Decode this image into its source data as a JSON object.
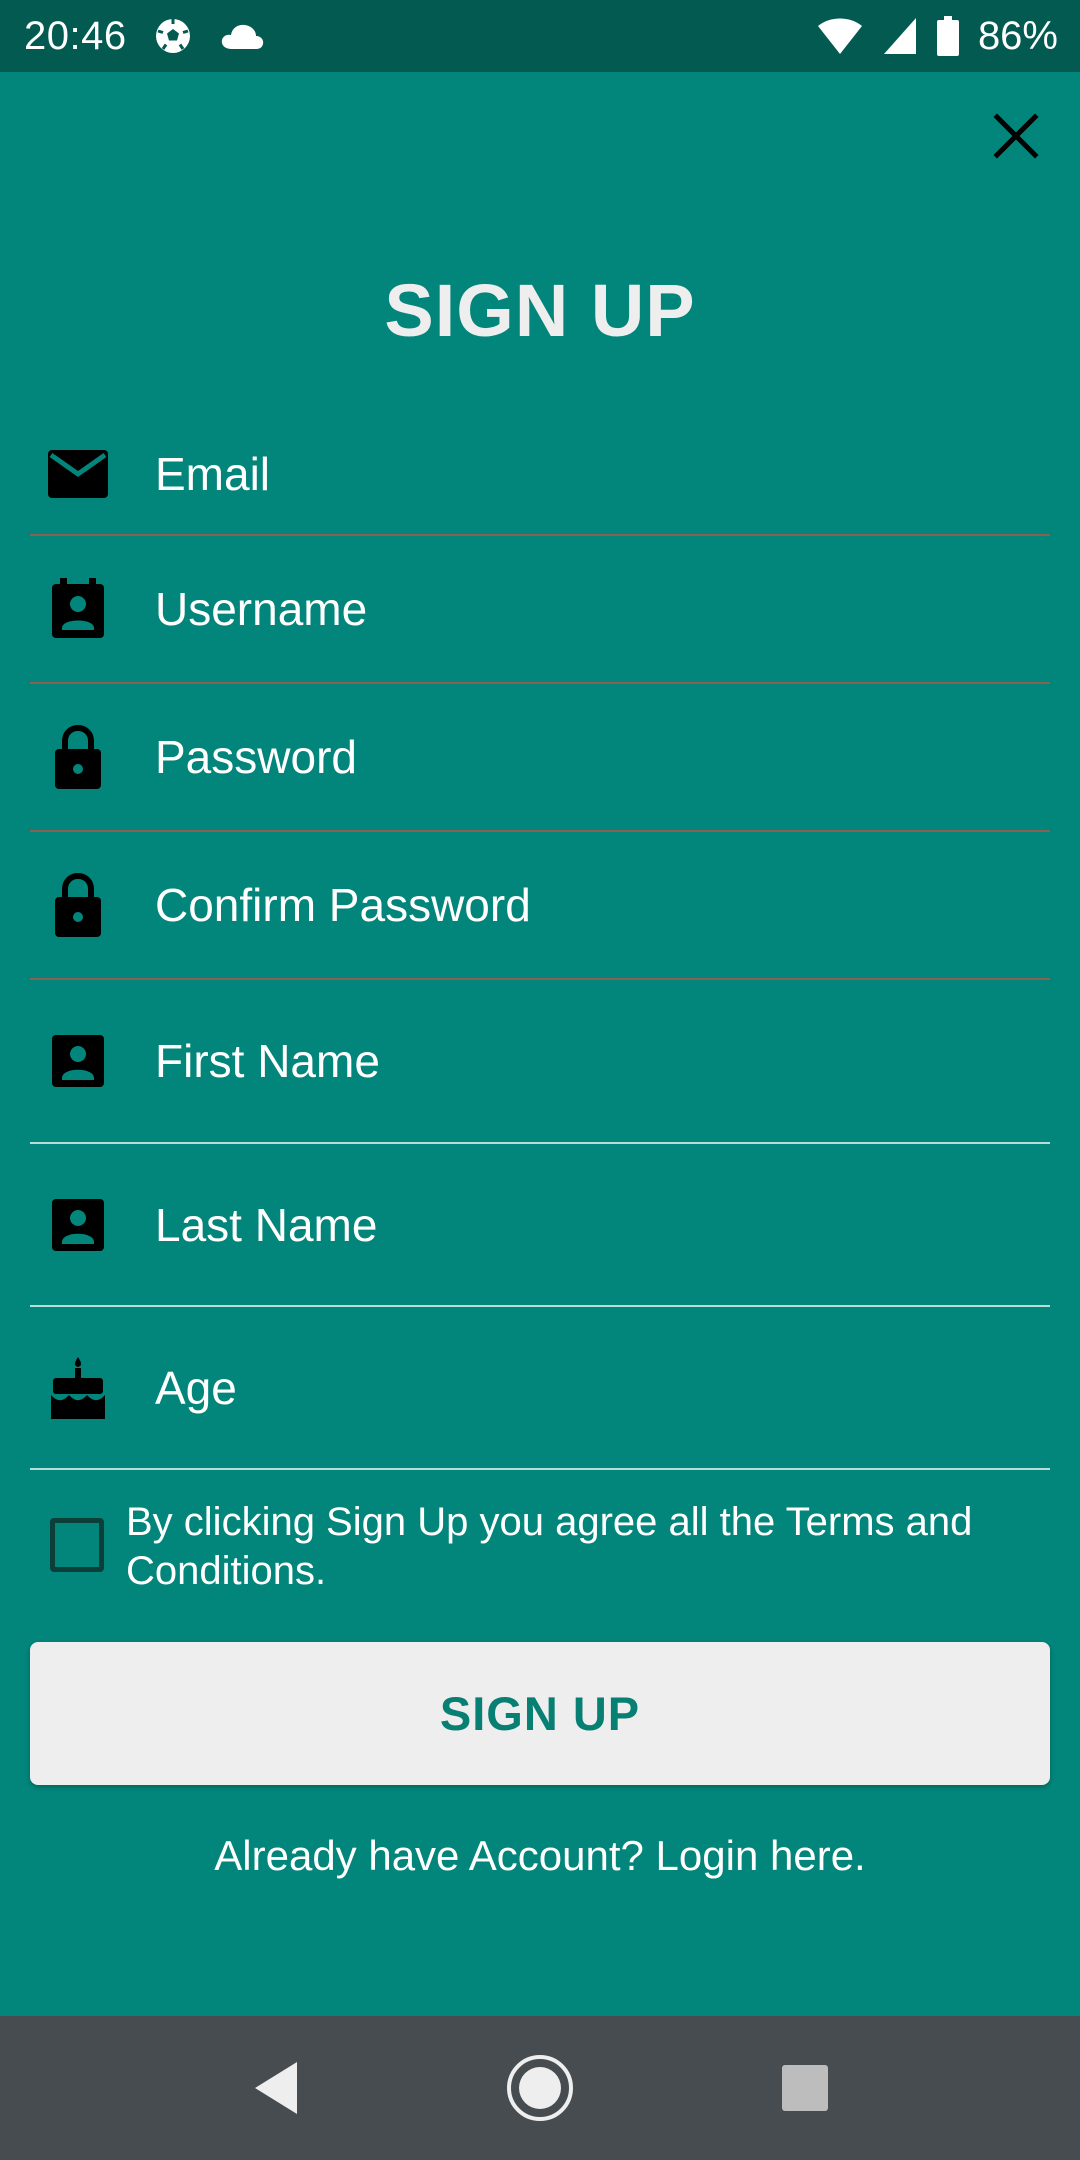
{
  "status_bar": {
    "time": "20:46",
    "left_icons": [
      "soccer-ball-icon",
      "cloud-icon"
    ],
    "right_icons": [
      "wifi-icon",
      "signal-icon",
      "battery-icon"
    ],
    "battery_percent": "86%"
  },
  "header": {
    "close_icon": "close-icon",
    "title": "SIGN UP"
  },
  "form": {
    "fields": [
      {
        "icon": "email-icon",
        "placeholder": "Email"
      },
      {
        "icon": "contact-card-icon",
        "placeholder": "Username"
      },
      {
        "icon": "lock-icon",
        "placeholder": "Password"
      },
      {
        "icon": "lock-icon",
        "placeholder": "Confirm Password"
      },
      {
        "icon": "person-box-icon",
        "placeholder": "First Name"
      },
      {
        "icon": "person-box-icon",
        "placeholder": "Last Name"
      },
      {
        "icon": "cake-icon",
        "placeholder": "Age"
      }
    ],
    "terms_checked": false,
    "terms_text": "By clicking Sign Up you agree all the Terms and Conditions.",
    "submit_label": "SIGN UP",
    "login_link": "Already have Account? Login here."
  },
  "nav_bar": {
    "buttons": [
      "back-icon",
      "home-icon",
      "recents-icon"
    ]
  },
  "colors": {
    "background": "#02857A",
    "status_bar": "#035A50",
    "nav_bar": "#464C50",
    "button_bg": "#EEEEEE",
    "button_text": "#077F73"
  }
}
